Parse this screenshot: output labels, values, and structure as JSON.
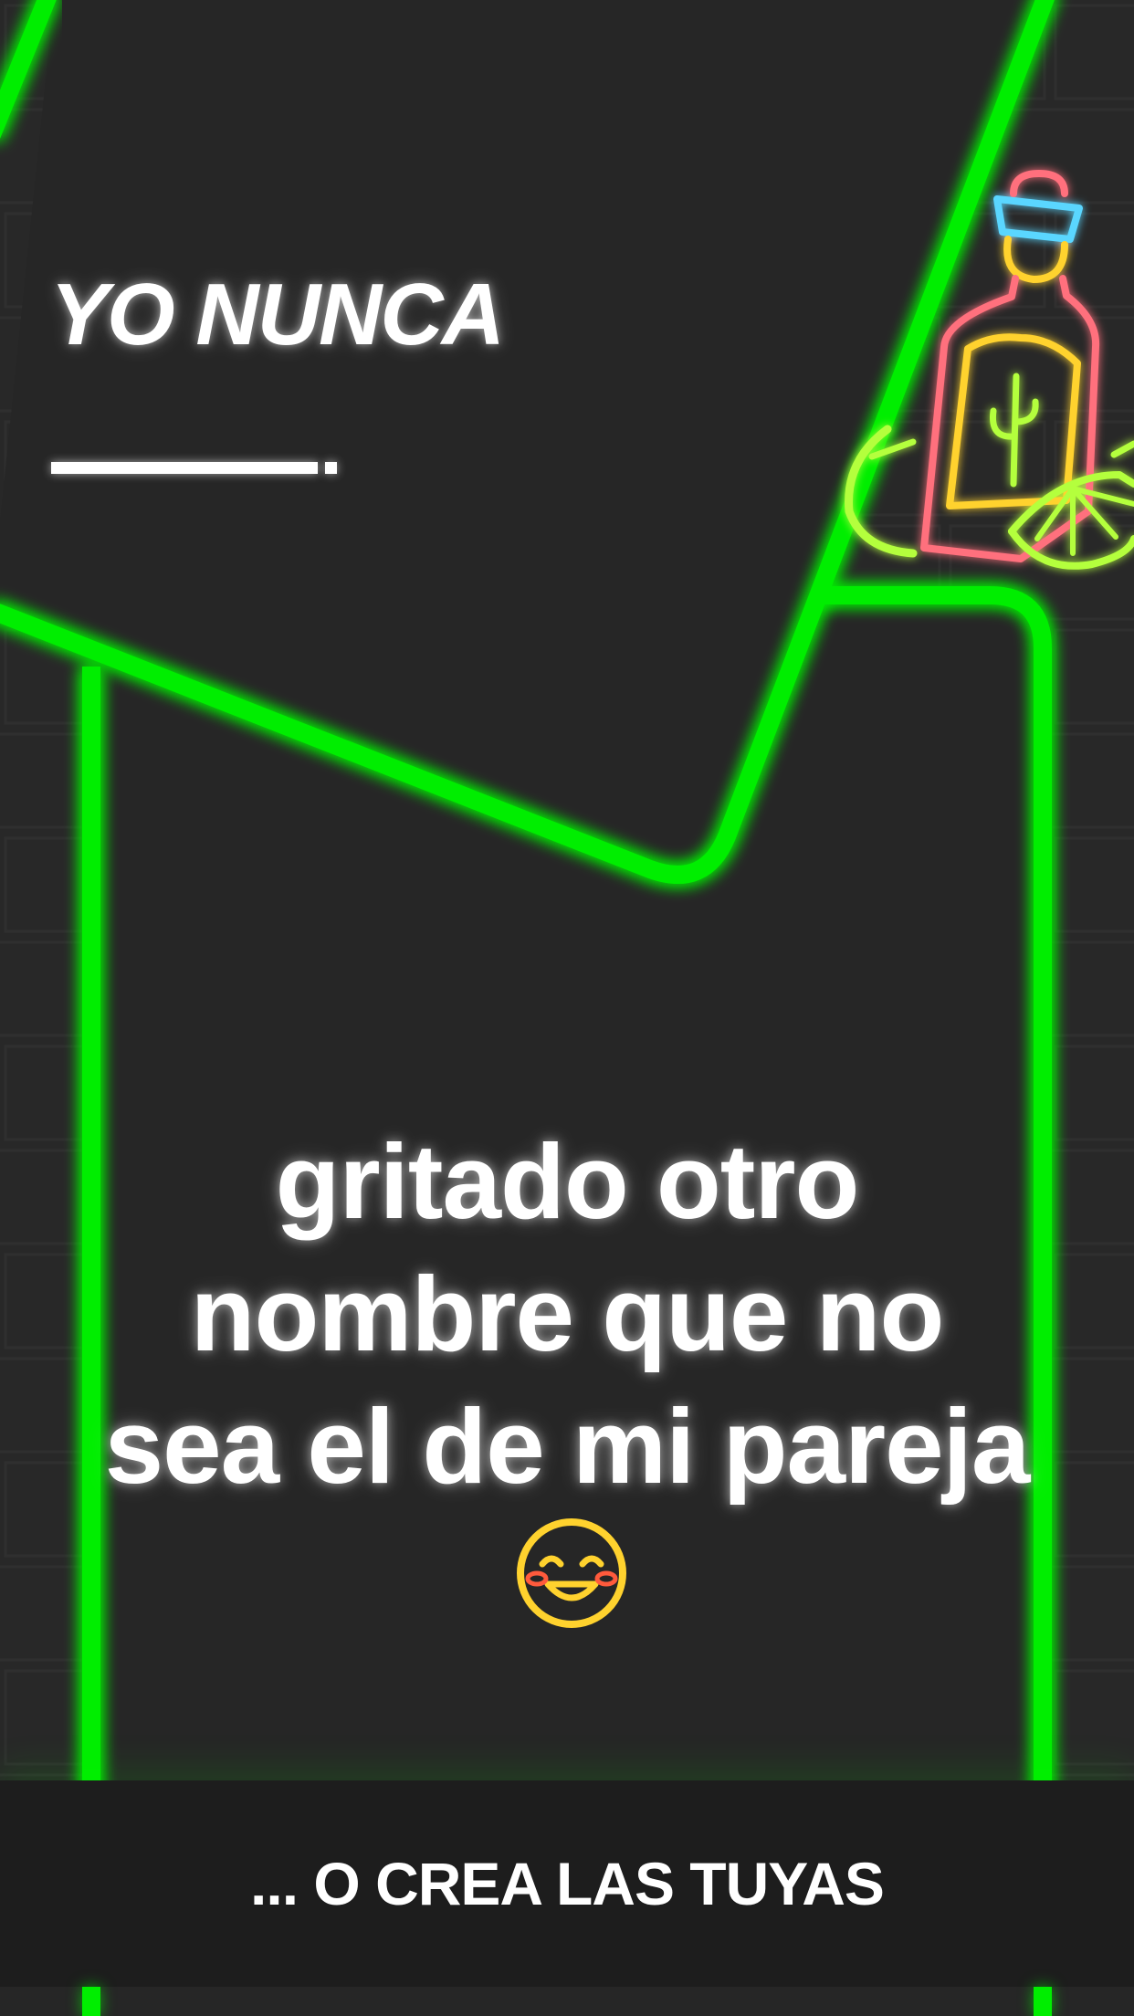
{
  "card": {
    "heading": "YO NUNCA",
    "statement": "gritado otro nombre que no sea el de mi pareja",
    "emoji": "smiling-face-with-blush-icon"
  },
  "cta": {
    "label": "... O CREA LAS TUYAS"
  },
  "decoration": {
    "neon_sign": "tequila-bottle-with-lime-icon"
  },
  "colors": {
    "background": "#282828",
    "neon_green": "#00ee00",
    "text": "#ffffff",
    "cta_bar": "#1d1d1d",
    "neon_pink": "#ff6f7d",
    "neon_yellow": "#ffd22e",
    "neon_cyan": "#5ad6ff",
    "neon_lime": "#b4ff3c"
  }
}
